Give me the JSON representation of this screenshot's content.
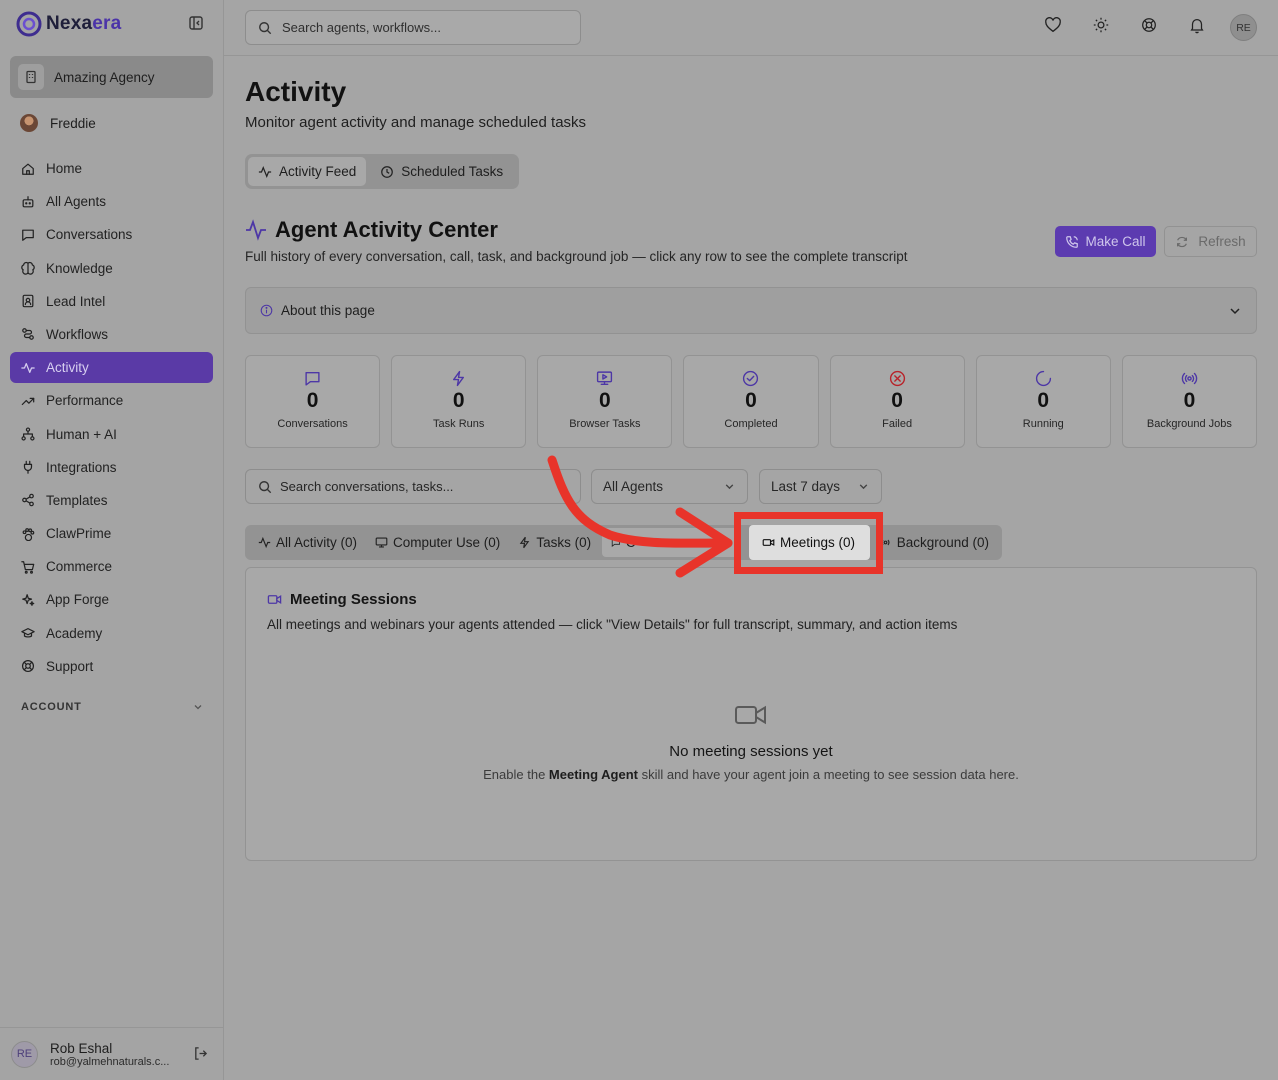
{
  "brand": {
    "name_a": "Nexa",
    "name_b": "era"
  },
  "sidebar": {
    "agency": "Amazing Agency",
    "user": "Freddie",
    "items": [
      {
        "label": "Home",
        "icon": "home-icon"
      },
      {
        "label": "All Agents",
        "icon": "bot-icon"
      },
      {
        "label": "Conversations",
        "icon": "message-icon"
      },
      {
        "label": "Knowledge",
        "icon": "brain-icon"
      },
      {
        "label": "Lead Intel",
        "icon": "contact-icon"
      },
      {
        "label": "Workflows",
        "icon": "workflow-icon"
      },
      {
        "label": "Activity",
        "icon": "activity-icon",
        "active": true
      },
      {
        "label": "Performance",
        "icon": "trending-icon"
      },
      {
        "label": "Human + AI",
        "icon": "network-icon"
      },
      {
        "label": "Integrations",
        "icon": "plug-icon"
      },
      {
        "label": "Templates",
        "icon": "share-icon"
      },
      {
        "label": "ClawPrime",
        "icon": "paw-icon"
      },
      {
        "label": "Commerce",
        "icon": "cart-icon"
      },
      {
        "label": "App Forge",
        "icon": "sparkles-icon"
      },
      {
        "label": "Academy",
        "icon": "graduation-icon"
      },
      {
        "label": "Support",
        "icon": "lifebuoy-icon"
      }
    ],
    "account_label": "ACCOUNT",
    "footer": {
      "initials": "RE",
      "name": "Rob Eshal",
      "email": "rob@yalmehnaturals.c..."
    }
  },
  "topbar": {
    "search_placeholder": "Search agents, workflows...",
    "avatar": "RE"
  },
  "page": {
    "title": "Activity",
    "subtitle": "Monitor agent activity and manage scheduled tasks",
    "tabs": [
      "Activity Feed",
      "Scheduled Tasks"
    ]
  },
  "activity_center": {
    "title": "Agent Activity Center",
    "subtitle": "Full history of every conversation, call, task, and background job — click any row to see the complete transcript",
    "make_call": "Make Call",
    "refresh": "Refresh",
    "about": "About this page"
  },
  "stats": [
    {
      "value": "0",
      "label": "Conversations",
      "icon": "message-icon",
      "color": "#4d37a6"
    },
    {
      "value": "0",
      "label": "Task Runs",
      "icon": "bolt-icon",
      "color": "#4d37a6"
    },
    {
      "value": "0",
      "label": "Browser Tasks",
      "icon": "monitor-icon",
      "color": "#4d37a6"
    },
    {
      "value": "0",
      "label": "Completed",
      "icon": "check-circle-icon",
      "color": "#4d37a6"
    },
    {
      "value": "0",
      "label": "Failed",
      "icon": "x-circle-icon",
      "color": "#b8232a"
    },
    {
      "value": "0",
      "label": "Running",
      "icon": "spinner-icon",
      "color": "#4d37a6"
    },
    {
      "value": "0",
      "label": "Background Jobs",
      "icon": "radio-icon",
      "color": "#4d37a6"
    }
  ],
  "filters": {
    "search_placeholder": "Search conversations, tasks...",
    "agents": "All Agents",
    "range": "Last 7 days"
  },
  "subtabs": [
    "All Activity (0)",
    "Computer Use (0)",
    "Tasks (0)",
    "C",
    "s (0",
    "Meetings (0)",
    "Background (0)"
  ],
  "panel": {
    "title": "Meeting Sessions",
    "subtitle": "All meetings and webinars your agents attended — click \"View Details\" for full transcript, summary, and action items",
    "empty_title": "No meeting sessions yet",
    "empty_pre": "Enable the ",
    "empty_bold": "Meeting Agent",
    "empty_post": " skill and have your agent join a meeting to see session data here."
  },
  "annotation_color": "#e8342a"
}
